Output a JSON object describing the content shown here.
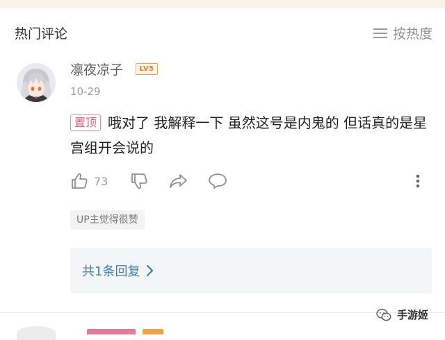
{
  "header": {
    "section_title": "热门评论",
    "sort_label": "按热度"
  },
  "comment": {
    "username": "凛夜凉子",
    "level_badge": "LV5",
    "date": "10-29",
    "pin_tag": "置顶",
    "text": "哦对了 我解释一下 虽然这号是内鬼的 但话真的是星宫组开会说的",
    "like_count": "73",
    "up_tag": "UP主觉得很赞",
    "replies_link": "共1条回复"
  },
  "watermark": {
    "text": "手游姬"
  },
  "colors": {
    "top_strip": "#fbf3e6",
    "level_badge": "#f07e1e",
    "pin_tag": "#ea5a73",
    "link": "#3f7fb6"
  },
  "icons": [
    "sort-lines-icon",
    "thumbs-up-icon",
    "thumbs-down-icon",
    "share-arrow-icon",
    "reply-bubble-icon",
    "more-vertical-icon",
    "chevron-right-icon",
    "wechat-icon"
  ]
}
